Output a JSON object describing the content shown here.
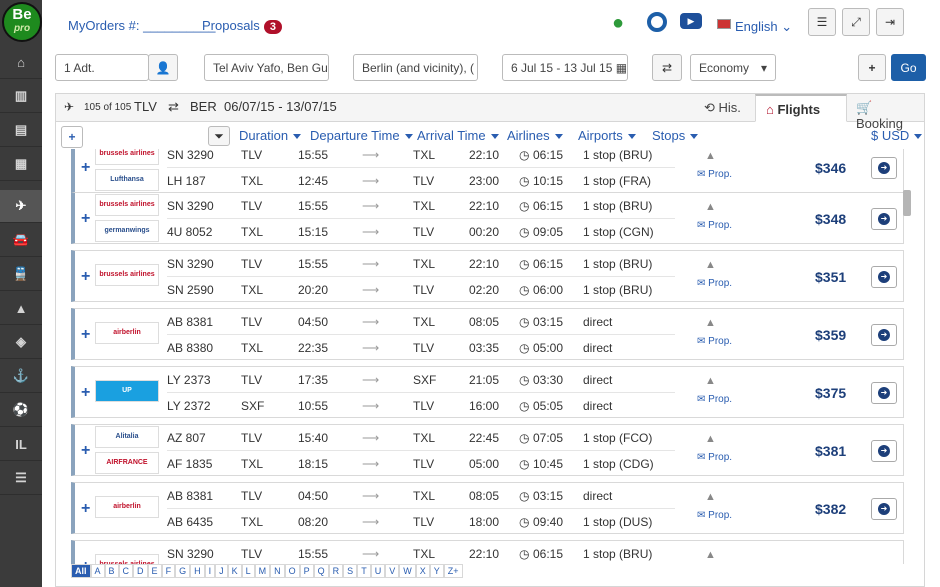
{
  "logo": {
    "top": "Be",
    "bottom": "pro"
  },
  "header": {
    "my_orders": "MyOrders #:",
    "my_orders_value": "__________",
    "proposals": "Proposals",
    "proposals_count": "3",
    "language": "English"
  },
  "search": {
    "passengers": "1 Adt.",
    "origin": "Tel Aviv Yafo, Ben Gu",
    "destination": "Berlin (and vicinity), (",
    "dates": "6 Jul 15 - 13 Jul 15",
    "cabin": "Economy",
    "go": "Go"
  },
  "summary": {
    "count": "105 of 105",
    "origin": "TLV",
    "destination": "BER",
    "dates": "06/07/15 - 13/07/15",
    "tab_history": "His.",
    "tab_flights": "Flights",
    "tab_booking": "Booking"
  },
  "sorts": [
    "Duration",
    "Departure Time",
    "Arrival Time",
    "Airlines",
    "Airports",
    "Stops"
  ],
  "currency": "$ USD",
  "sidebar": [
    "IL"
  ],
  "alphabet": [
    "All",
    "A",
    "B",
    "C",
    "D",
    "E",
    "F",
    "G",
    "H",
    "I",
    "J",
    "K",
    "L",
    "M",
    "N",
    "O",
    "P",
    "Q",
    "R",
    "S",
    "T",
    "U",
    "V",
    "W",
    "X",
    "Y",
    "Z+"
  ],
  "results": [
    {
      "logos": [
        "brussels airlines",
        "Lufthansa"
      ],
      "price": "$346",
      "legs": [
        {
          "flight": "SN 3290",
          "from": "TLV",
          "dep": "15:55",
          "to": "TXL",
          "arr": "22:10",
          "dur": "06:15",
          "stops": "1 stop (BRU)"
        },
        {
          "flight": "LH 187",
          "from": "TXL",
          "dep": "12:45",
          "to": "TLV",
          "arr": "23:00",
          "dur": "10:15",
          "stops": "1 stop (FRA)"
        }
      ]
    },
    {
      "logos": [
        "brussels airlines",
        "germanwings"
      ],
      "price": "$348",
      "legs": [
        {
          "flight": "SN 3290",
          "from": "TLV",
          "dep": "15:55",
          "to": "TXL",
          "arr": "22:10",
          "dur": "06:15",
          "stops": "1 stop (BRU)"
        },
        {
          "flight": "4U 8052",
          "from": "TXL",
          "dep": "15:15",
          "to": "TLV",
          "arr": "00:20",
          "dur": "09:05",
          "stops": "1 stop (CGN)"
        }
      ]
    },
    {
      "logos": [
        "brussels airlines"
      ],
      "price": "$351",
      "legs": [
        {
          "flight": "SN 3290",
          "from": "TLV",
          "dep": "15:55",
          "to": "TXL",
          "arr": "22:10",
          "dur": "06:15",
          "stops": "1 stop (BRU)"
        },
        {
          "flight": "SN 2590",
          "from": "TXL",
          "dep": "20:20",
          "to": "TLV",
          "arr": "02:20",
          "dur": "06:00",
          "stops": "1 stop (BRU)"
        }
      ]
    },
    {
      "logos": [
        "airberlin"
      ],
      "price": "$359",
      "legs": [
        {
          "flight": "AB 8381",
          "from": "TLV",
          "dep": "04:50",
          "to": "TXL",
          "arr": "08:05",
          "dur": "03:15",
          "stops": "direct"
        },
        {
          "flight": "AB 8380",
          "from": "TXL",
          "dep": "22:35",
          "to": "TLV",
          "arr": "03:35",
          "dur": "05:00",
          "stops": "direct"
        }
      ]
    },
    {
      "logos": [
        "UP"
      ],
      "price": "$375",
      "legs": [
        {
          "flight": "LY 2373",
          "from": "TLV",
          "dep": "17:35",
          "to": "SXF",
          "arr": "21:05",
          "dur": "03:30",
          "stops": "direct"
        },
        {
          "flight": "LY 2372",
          "from": "SXF",
          "dep": "10:55",
          "to": "TLV",
          "arr": "16:00",
          "dur": "05:05",
          "stops": "direct"
        }
      ]
    },
    {
      "logos": [
        "Alitalia",
        "AIRFRANCE"
      ],
      "price": "$381",
      "legs": [
        {
          "flight": "AZ 807",
          "from": "TLV",
          "dep": "15:40",
          "to": "TXL",
          "arr": "22:45",
          "dur": "07:05",
          "stops": "1 stop (FCO)"
        },
        {
          "flight": "AF 1835",
          "from": "TXL",
          "dep": "18:15",
          "to": "TLV",
          "arr": "05:00",
          "dur": "10:45",
          "stops": "1 stop (CDG)"
        }
      ]
    },
    {
      "logos": [
        "airberlin"
      ],
      "price": "$382",
      "legs": [
        {
          "flight": "AB 8381",
          "from": "TLV",
          "dep": "04:50",
          "to": "TXL",
          "arr": "08:05",
          "dur": "03:15",
          "stops": "direct"
        },
        {
          "flight": "AB 6435",
          "from": "TXL",
          "dep": "08:20",
          "to": "TLV",
          "arr": "18:00",
          "dur": "09:40",
          "stops": "1 stop (DUS)"
        }
      ]
    },
    {
      "logos": [
        "brussels airlines"
      ],
      "price": "",
      "legs": [
        {
          "flight": "SN 3290",
          "from": "TLV",
          "dep": "15:55",
          "to": "TXL",
          "arr": "22:10",
          "dur": "06:15",
          "stops": "1 stop (BRU)"
        }
      ]
    }
  ],
  "prop_label": "Prop."
}
